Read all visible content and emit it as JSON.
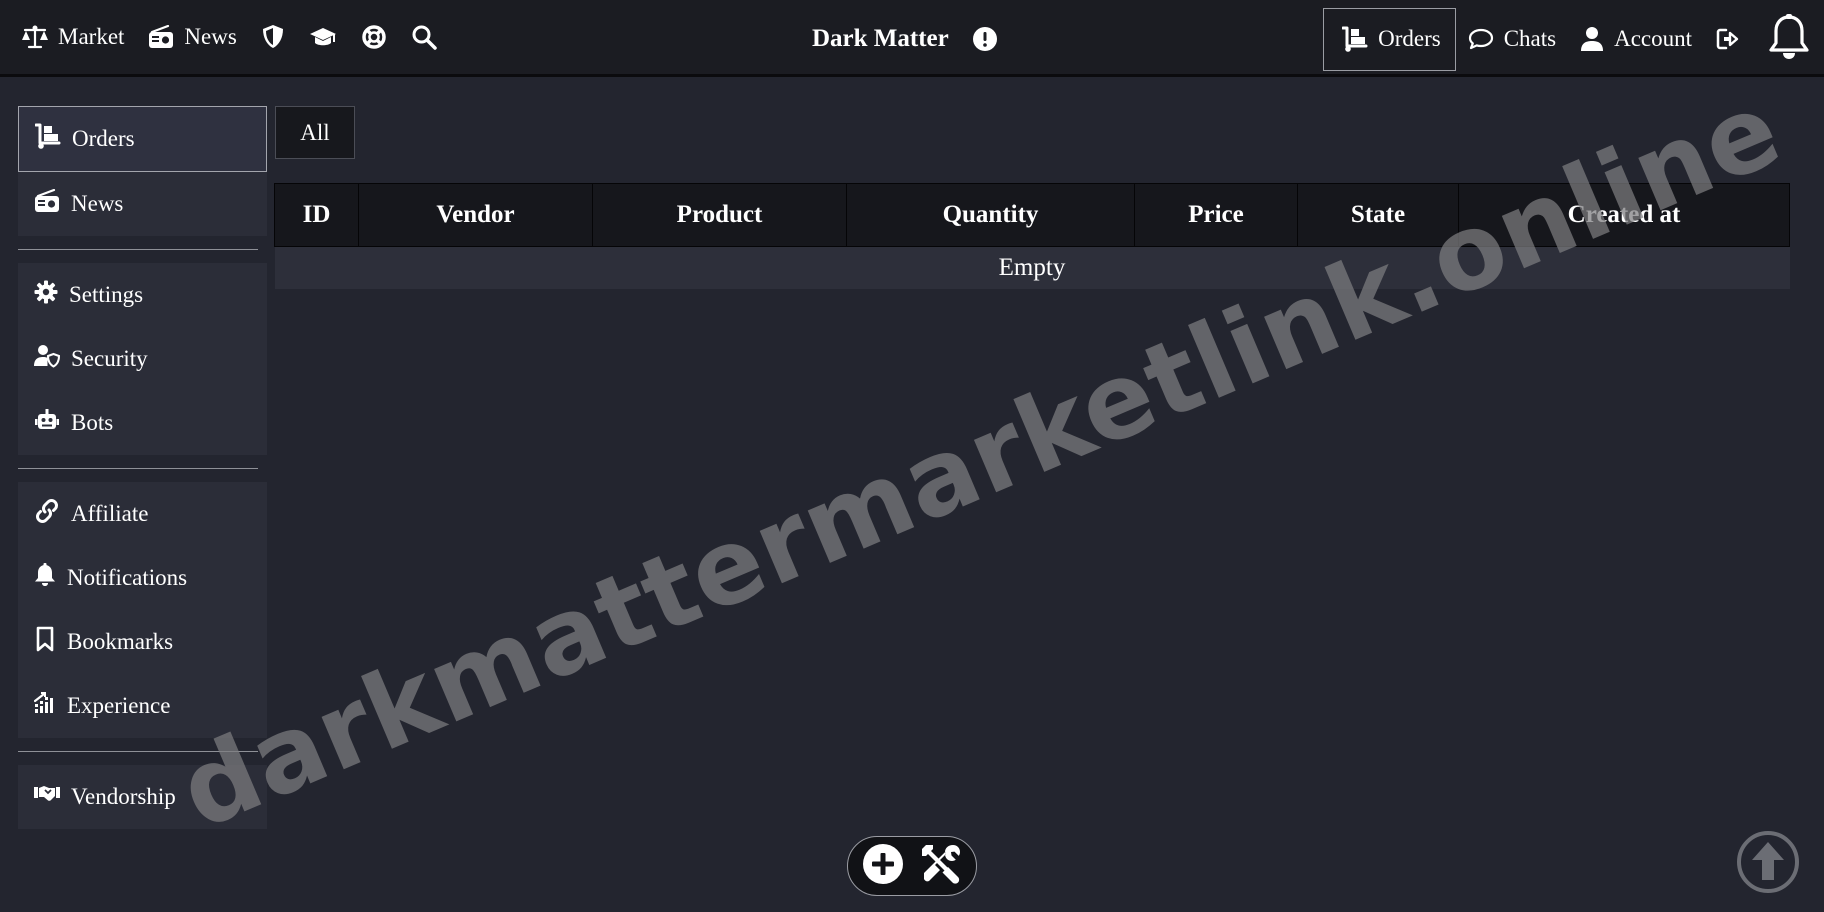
{
  "topbar": {
    "left_items": [
      {
        "label": "Market",
        "icon": "scale-icon"
      },
      {
        "label": "News",
        "icon": "radio-icon"
      },
      {
        "label": "",
        "icon": "shield-icon"
      },
      {
        "label": "",
        "icon": "graduation-cap-icon"
      },
      {
        "label": "",
        "icon": "lifebuoy-icon"
      },
      {
        "label": "",
        "icon": "search-icon"
      }
    ],
    "brand": "Dark Matter",
    "right_items": [
      {
        "label": "Orders",
        "icon": "dolly-icon"
      },
      {
        "label": "Chats",
        "icon": "chat-bubble-icon"
      },
      {
        "label": "Account",
        "icon": "user-icon"
      },
      {
        "label": "",
        "icon": "logout-icon"
      }
    ]
  },
  "sidebar": {
    "group1": [
      {
        "label": "Orders",
        "icon": "dolly-icon",
        "active": true
      },
      {
        "label": "News",
        "icon": "radio-icon"
      }
    ],
    "group2": [
      {
        "label": "Settings",
        "icon": "gear-icon"
      },
      {
        "label": "Security",
        "icon": "user-shield-icon"
      },
      {
        "label": "Bots",
        "icon": "robot-icon"
      }
    ],
    "group3": [
      {
        "label": "Affiliate",
        "icon": "link-icon"
      },
      {
        "label": "Notifications",
        "icon": "bell-icon"
      },
      {
        "label": "Bookmarks",
        "icon": "bookmark-icon"
      },
      {
        "label": "Experience",
        "icon": "chart-icon"
      }
    ],
    "group4": [
      {
        "label": "Vendorship",
        "icon": "handshake-icon"
      }
    ]
  },
  "main": {
    "filter_label": "All",
    "table": {
      "columns": [
        "ID",
        "Vendor",
        "Product",
        "Quantity",
        "Price",
        "State",
        "Created at"
      ],
      "empty_text": "Empty"
    }
  },
  "watermark": "darkmattermarketlink.online"
}
